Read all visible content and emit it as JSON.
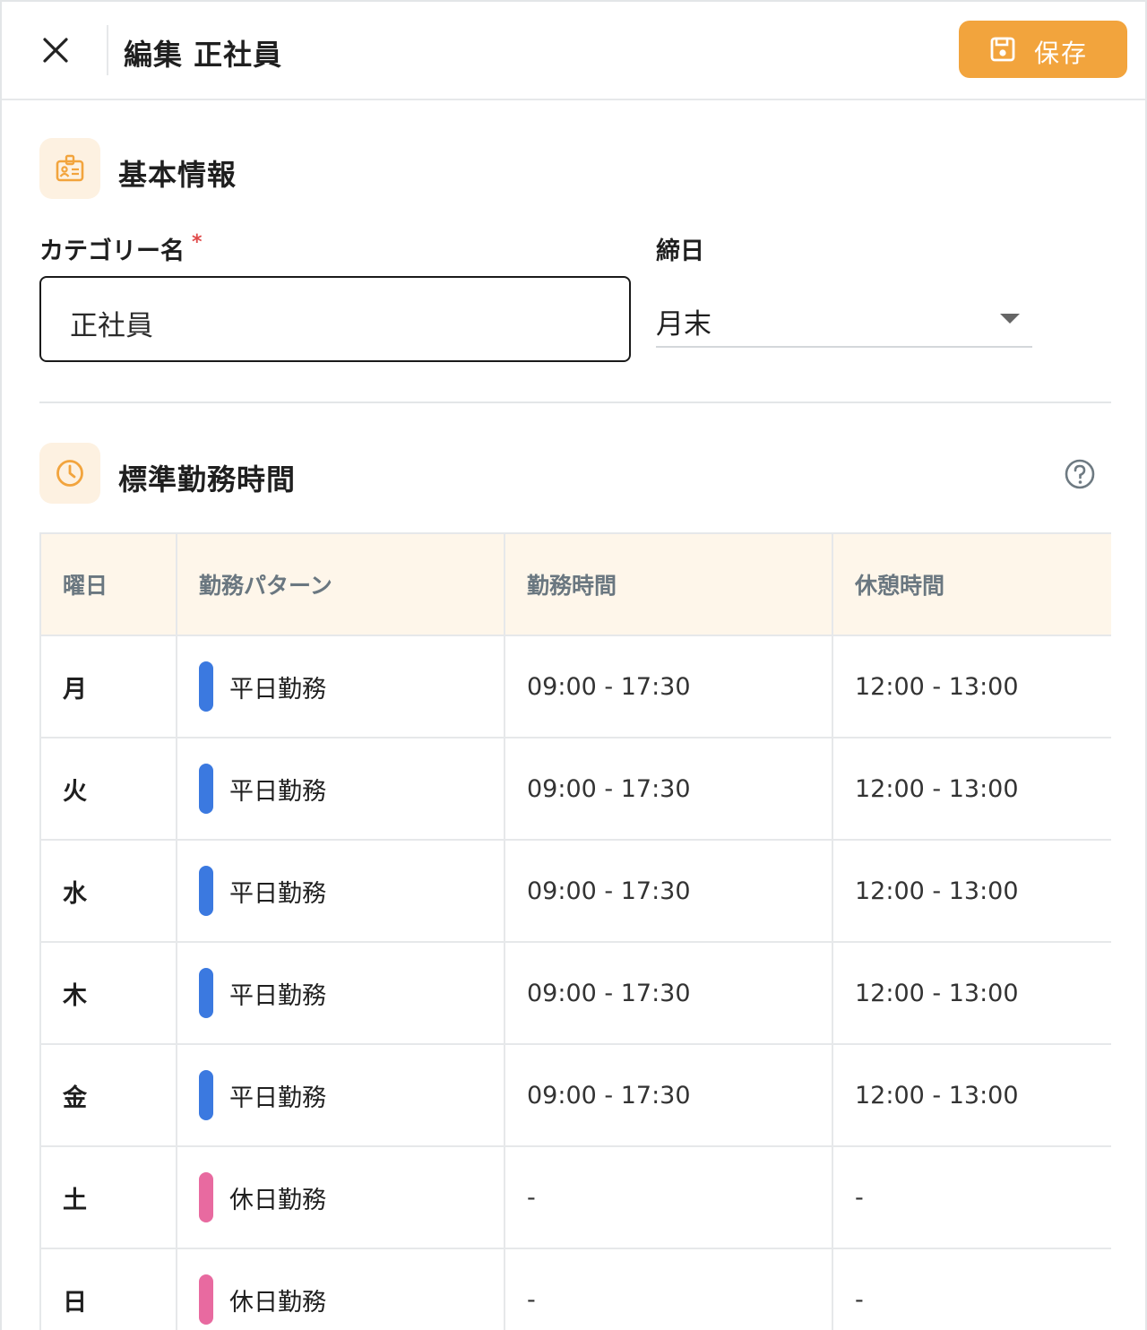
{
  "header": {
    "title": "編集 正社員",
    "save_label": "保存"
  },
  "basic_info": {
    "title": "基本情報",
    "category_label": "カテゴリー名",
    "required_mark": "*",
    "category_value": "正社員",
    "closing_label": "締日",
    "closing_value": "月末"
  },
  "work_hours": {
    "title": "標準勤務時間",
    "columns": [
      "曜日",
      "勤務パターン",
      "勤務時間",
      "休憩時間"
    ],
    "rows": [
      {
        "day": "月",
        "pattern": "平日勤務",
        "pattern_color": "#3b79e0",
        "work": "09:00 - 17:30",
        "break": "12:00 - 13:00"
      },
      {
        "day": "火",
        "pattern": "平日勤務",
        "pattern_color": "#3b79e0",
        "work": "09:00 - 17:30",
        "break": "12:00 - 13:00"
      },
      {
        "day": "水",
        "pattern": "平日勤務",
        "pattern_color": "#3b79e0",
        "work": "09:00 - 17:30",
        "break": "12:00 - 13:00"
      },
      {
        "day": "木",
        "pattern": "平日勤務",
        "pattern_color": "#3b79e0",
        "work": "09:00 - 17:30",
        "break": "12:00 - 13:00"
      },
      {
        "day": "金",
        "pattern": "平日勤務",
        "pattern_color": "#3b79e0",
        "work": "09:00 - 17:30",
        "break": "12:00 - 13:00"
      },
      {
        "day": "土",
        "pattern": "休日勤務",
        "pattern_color": "#e86aa0",
        "work": "-",
        "break": "-"
      },
      {
        "day": "日",
        "pattern": "休日勤務",
        "pattern_color": "#e86aa0",
        "work": "-",
        "break": "-"
      }
    ]
  },
  "colors": {
    "accent": "#f2a43d",
    "weekday": "#3b79e0",
    "holiday": "#e86aa0"
  }
}
